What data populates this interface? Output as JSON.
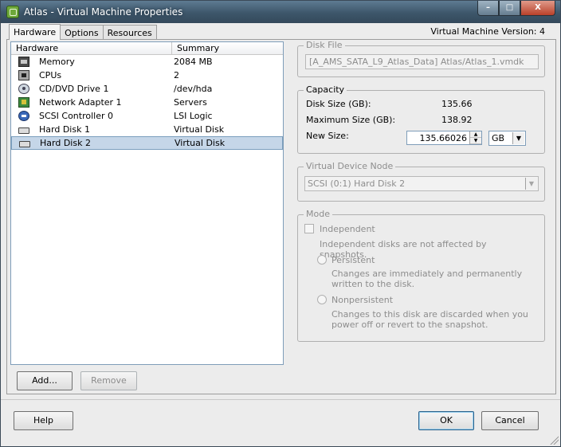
{
  "window": {
    "title": "Atlas - Virtual Machine Properties",
    "controls": {
      "minimize": "–",
      "maximize": "□",
      "close": "X"
    }
  },
  "tabs": [
    {
      "label": "Hardware",
      "active": true
    },
    {
      "label": "Options"
    },
    {
      "label": "Resources"
    }
  ],
  "vm_version": "Virtual Machine Version: 4",
  "hardware_list": {
    "headers": {
      "hardware": "Hardware",
      "summary": "Summary"
    },
    "items": [
      {
        "name": "Memory",
        "summary": "2084 MB",
        "icon": "memory-icon"
      },
      {
        "name": "CPUs",
        "summary": "2",
        "icon": "cpu-icon"
      },
      {
        "name": "CD/DVD Drive 1",
        "summary": "/dev/hda",
        "icon": "cd-dvd-icon"
      },
      {
        "name": "Network Adapter 1",
        "summary": "Servers",
        "icon": "network-adapter-icon"
      },
      {
        "name": "SCSI Controller 0",
        "summary": "LSI Logic",
        "icon": "scsi-controller-icon"
      },
      {
        "name": "Hard Disk 1",
        "summary": "Virtual Disk",
        "icon": "hard-disk-icon"
      },
      {
        "name": "Hard Disk 2",
        "summary": "Virtual Disk",
        "icon": "hard-disk-icon",
        "selected": true
      }
    ]
  },
  "buttons": {
    "add": "Add...",
    "remove": "Remove",
    "help": "Help",
    "ok": "OK",
    "cancel": "Cancel"
  },
  "disk_file": {
    "title": "Disk File",
    "value": "[A_AMS_SATA_L9_Atlas_Data] Atlas/Atlas_1.vmdk"
  },
  "capacity": {
    "title": "Capacity",
    "disk_size_label": "Disk Size (GB):",
    "disk_size_value": "135.66",
    "max_size_label": "Maximum Size (GB):",
    "max_size_value": "138.92",
    "new_size_label": "New Size:",
    "new_size_value": "135.66026",
    "unit": "GB"
  },
  "virtual_device_node": {
    "title": "Virtual Device Node",
    "value": "SCSI (0:1) Hard Disk 2"
  },
  "mode": {
    "title": "Mode",
    "independent_label": "Independent",
    "independent_desc": "Independent disks are not affected by snapshots.",
    "persistent_label": "Persistent",
    "persistent_desc": "Changes are immediately and permanently written to the disk.",
    "nonpersistent_label": "Nonpersistent",
    "nonpersistent_desc": "Changes to this disk are discarded when you power off or revert to the snapshot."
  },
  "colors": {
    "selection": "#c5d6e8",
    "titlebar": "#3d566a",
    "disabled_text": "#8d8d8d"
  }
}
